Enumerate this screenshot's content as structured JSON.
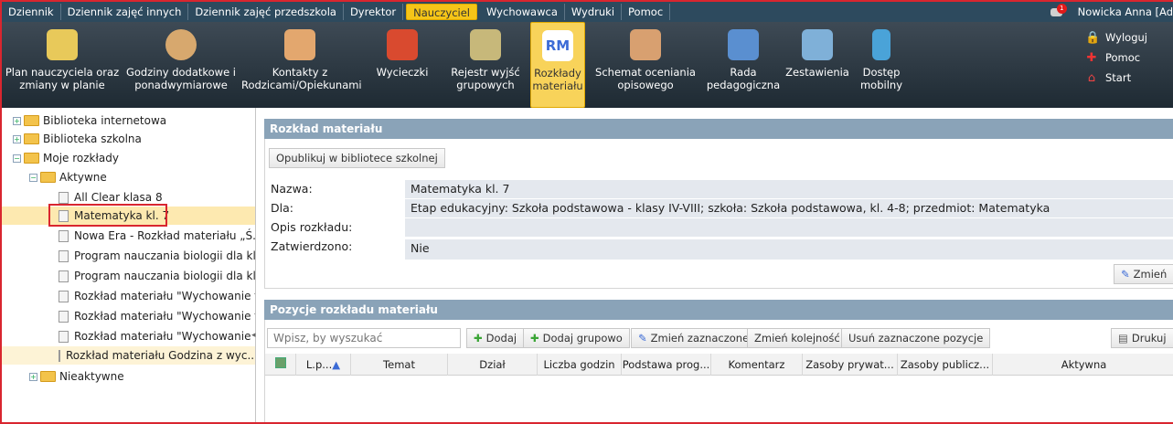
{
  "top_menu": [
    "Dziennik",
    "Dziennik zajęć innych",
    "Dziennik zajęć przedszkola",
    "Dyrektor",
    "Nauczyciel",
    "Wychowawca",
    "Wydruki",
    "Pomoc"
  ],
  "top_menu_active": "Nauczyciel",
  "user": {
    "name": "Nowicka Anna [Ad",
    "badge": "1"
  },
  "toolbar": [
    {
      "label": "Plan nauczyciela oraz zmiany w planie",
      "icon": "teacher-plan-icon"
    },
    {
      "label": "Godziny dodatkowe i ponadwymiarowe",
      "icon": "extra-hours-icon"
    },
    {
      "label": "Kontakty z Rodzicami/Opiekunami",
      "icon": "parents-contact-icon"
    },
    {
      "label": "Wycieczki",
      "icon": "backpack-icon"
    },
    {
      "label": "Rejestr wyjść grupowych",
      "icon": "group-exit-icon"
    },
    {
      "label": "Rozkłady materiału",
      "icon": "rm-icon",
      "icon_text": "RM"
    },
    {
      "label": "Schemat oceniania opisowego",
      "icon": "grading-scheme-icon"
    },
    {
      "label": "Rada pedagogiczna",
      "icon": "pedagogical-council-icon"
    },
    {
      "label": "Zestawienia",
      "icon": "summary-icon"
    },
    {
      "label": "Dostęp mobilny",
      "icon": "mobile-access-icon"
    }
  ],
  "side_links": [
    {
      "label": "Wyloguj",
      "icon": "lock-icon"
    },
    {
      "label": "Pomoc",
      "icon": "help-icon"
    },
    {
      "label": "Start",
      "icon": "home-icon"
    }
  ],
  "tree": {
    "biblioteka_internetowa": "Biblioteka internetowa",
    "biblioteka_szkolna": "Biblioteka szkolna",
    "moje_rozklady": "Moje rozkłady",
    "aktywne": "Aktywne",
    "items": [
      "All Clear klasa 8",
      "Matematyka kl. 7",
      "Nowa Era - Rozkład materiału „Ś...",
      "Program nauczania biologii dla kla...",
      "Program nauczania biologii dla kla...",
      "Rozkład materiału \"Wychowanie fi...",
      "Rozkład materiału \"Wychowanie fi...",
      "Rozkład materiału \"Wychowanie fi...",
      "Rozkład materiału Godzina z wyc..."
    ],
    "nieaktywne": "Nieaktywne"
  },
  "panel1": {
    "title": "Rozkład materiału",
    "publish_button": "Opublikuj w bibliotece szkolnej",
    "fields": [
      {
        "label": "Nazwa:",
        "value": "Matematyka kl. 7"
      },
      {
        "label": "Dla:",
        "value": "Etap edukacyjny: Szkoła podstawowa - klasy IV-VIII; szkoła: Szkoła podstawowa, kl. 4-8; przedmiot: Matematyka"
      },
      {
        "label": "Opis rozkładu:",
        "value": ""
      },
      {
        "label": "Zatwierdzono:",
        "value": "Nie"
      }
    ],
    "edit_button": "Zmień"
  },
  "panel2": {
    "title": "Pozycje rozkładu materiału",
    "search_placeholder": "Wpisz, by wyszukać",
    "buttons": {
      "add": "Dodaj",
      "add_group": "Dodaj grupowo",
      "edit_selected": "Zmień zaznaczone",
      "reorder": "Zmień kolejność",
      "delete_selected": "Usuń zaznaczone pozycje",
      "print": "Drukuj"
    },
    "columns": [
      "L.p...",
      "Temat",
      "Dział",
      "Liczba godzin",
      "Podstawa prog...",
      "Komentarz",
      "Zasoby prywat...",
      "Zasoby publicz...",
      "Aktywna"
    ]
  }
}
